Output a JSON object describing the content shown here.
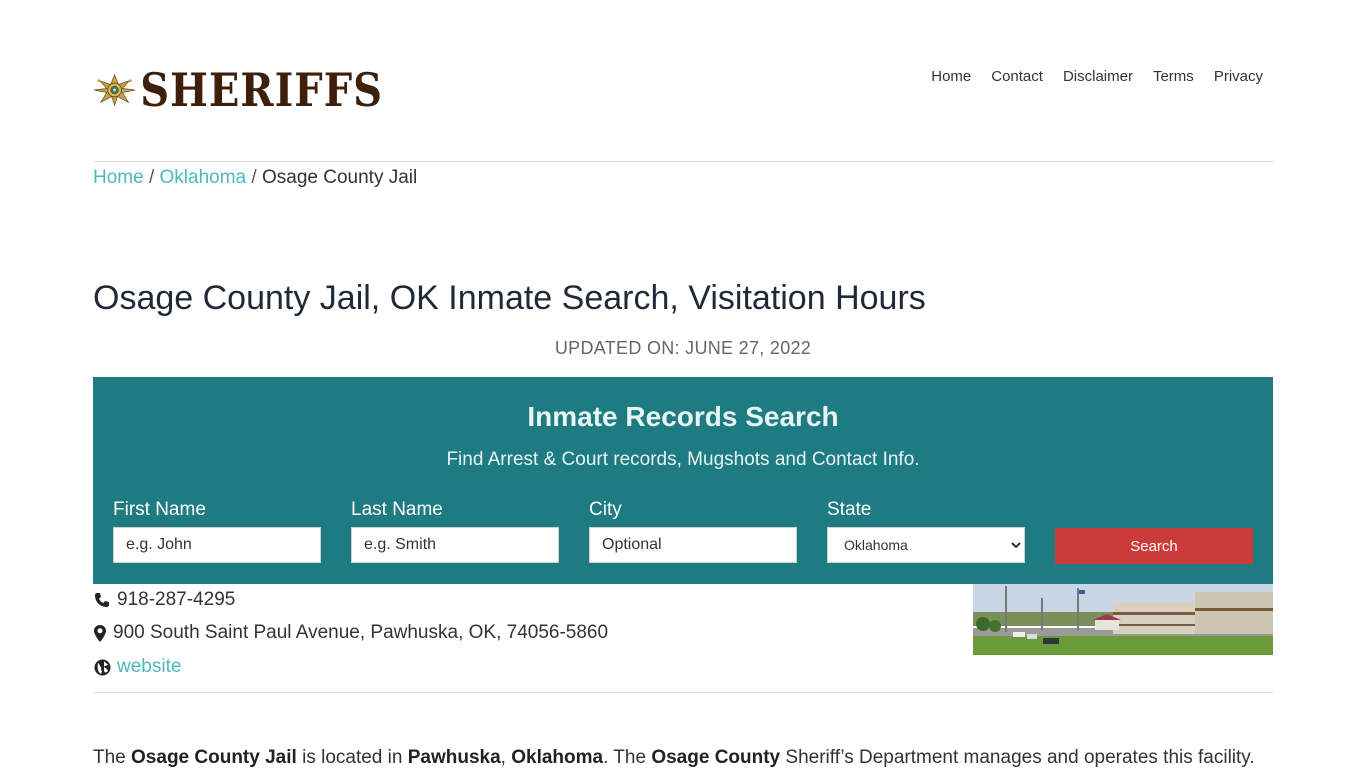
{
  "header": {
    "logo_text": "SHERIFFS",
    "nav": [
      "Home",
      "Contact",
      "Disclaimer",
      "Terms",
      "Privacy"
    ]
  },
  "breadcrumb": {
    "items": [
      "Home",
      "Oklahoma"
    ],
    "current": "Osage County Jail",
    "separator": "/"
  },
  "page": {
    "title": "Osage County Jail, OK Inmate Search, Visitation Hours",
    "updated": "UPDATED ON: JUNE 27, 2022"
  },
  "search": {
    "title": "Inmate Records Search",
    "subtitle": "Find Arrest & Court records, Mugshots and Contact Info.",
    "first_name_label": "First Name",
    "first_name_placeholder": "e.g. John",
    "last_name_label": "Last Name",
    "last_name_placeholder": "e.g. Smith",
    "city_label": "City",
    "city_placeholder": "Optional",
    "state_label": "State",
    "state_selected": "Oklahoma",
    "button_label": "Search",
    "colors": {
      "panel": "#1f7b82",
      "button": "#cc3b3b"
    }
  },
  "contact": {
    "phone": "918-287-4295",
    "address": "900 South Saint Paul Avenue, Pawhuska, OK, 74056-5860",
    "website_label": "website",
    "icons": [
      "phone-icon",
      "map-marker-icon",
      "globe-icon"
    ]
  },
  "intro": {
    "p1": "The ",
    "b1": "Osage County Jail",
    "p2": " is located in ",
    "b2": "Pawhuska",
    "p3": ", ",
    "b3": "Oklahoma",
    "p4": ". The ",
    "b4": "Osage County",
    "p5": " Sheriff’s Department manages and operates this facility."
  }
}
